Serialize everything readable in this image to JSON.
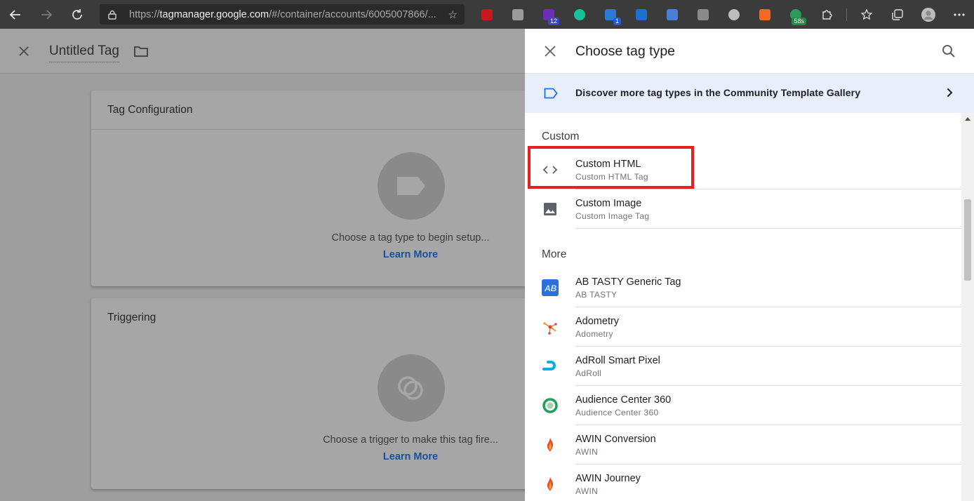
{
  "browser": {
    "url_prefix": "https://",
    "url_host": "tagmanager.google.com",
    "url_path": "/#/container/accounts/6005007866/...",
    "extension_badges": [
      "12",
      "1",
      "58s"
    ]
  },
  "page": {
    "tag_name": "Untitled Tag",
    "tag_configuration": {
      "title": "Tag Configuration",
      "hint": "Choose a tag type to begin setup...",
      "link": "Learn More"
    },
    "triggering": {
      "title": "Triggering",
      "hint": "Choose a trigger to make this tag fire...",
      "link": "Learn More"
    }
  },
  "panel": {
    "title": "Choose tag type",
    "gallery_text": "Discover more tag types in the Community Template Gallery",
    "sections": {
      "custom": "Custom",
      "more": "More"
    },
    "custom_items": [
      {
        "title": "Custom HTML",
        "subtitle": "Custom HTML Tag",
        "icon": "code-brackets-icon"
      },
      {
        "title": "Custom Image",
        "subtitle": "Custom Image Tag",
        "icon": "image-icon"
      }
    ],
    "more_items": [
      {
        "title": "AB TASTY Generic Tag",
        "subtitle": "AB TASTY",
        "icon": "ab-tasty-icon"
      },
      {
        "title": "Adometry",
        "subtitle": "Adometry",
        "icon": "adometry-icon"
      },
      {
        "title": "AdRoll Smart Pixel",
        "subtitle": "AdRoll",
        "icon": "adroll-icon"
      },
      {
        "title": "Audience Center 360",
        "subtitle": "Audience Center 360",
        "icon": "audience-center-icon"
      },
      {
        "title": "AWIN Conversion",
        "subtitle": "AWIN",
        "icon": "awin-icon"
      },
      {
        "title": "AWIN Journey",
        "subtitle": "AWIN",
        "icon": "awin-icon"
      }
    ]
  },
  "colors": {
    "highlight": "#e5211c",
    "link": "#1a73e8",
    "gallery_bg": "#e8eefb"
  }
}
